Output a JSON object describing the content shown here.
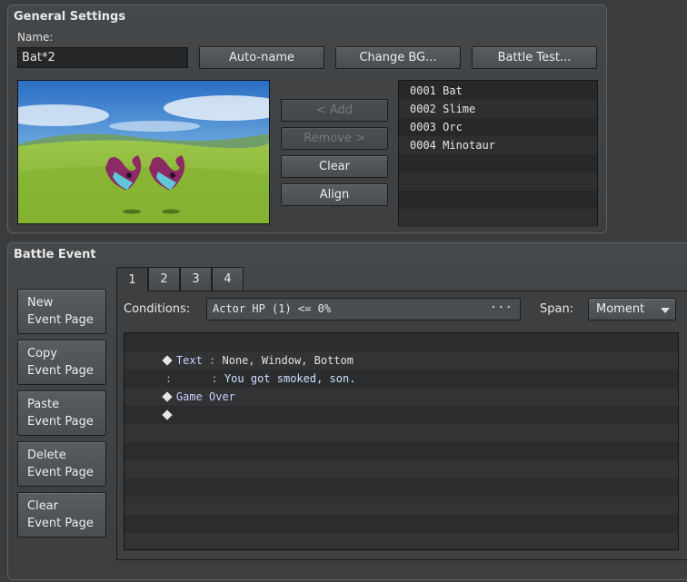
{
  "general": {
    "title": "General Settings",
    "name_label": "Name:",
    "name_value": "Bat*2",
    "autoname_label": "Auto-name",
    "changebg_label": "Change BG...",
    "battletest_label": "Battle Test...",
    "add_label": "< Add",
    "remove_label": "Remove >",
    "clear_label": "Clear",
    "align_label": "Align",
    "enemies": [
      "0001 Bat",
      "0002 Slime",
      "0003 Orc",
      "0004 Minotaur",
      "",
      "",
      "",
      ""
    ]
  },
  "battle_event": {
    "title": "Battle Event",
    "page_buttons": [
      "New\nEvent Page",
      "Copy\nEvent Page",
      "Paste\nEvent Page",
      "Delete\nEvent Page",
      "Clear\nEvent Page"
    ],
    "tabs": [
      "1",
      "2",
      "3",
      "4"
    ],
    "active_tab": "1",
    "conditions_label": "Conditions:",
    "conditions_value": "Actor HP (1) <= 0%",
    "conditions_more": "···",
    "span_label": "Span:",
    "span_value": "Moment",
    "commands": [
      {
        "marker": "diamond",
        "key": "Text",
        "sep": " : ",
        "args": "None, Window, Bottom"
      },
      {
        "marker": "",
        "key": ":     ",
        "sep": " : ",
        "args": "You got smoked, son."
      },
      {
        "marker": "diamond",
        "key": "Game Over",
        "sep": "",
        "args": ""
      },
      {
        "marker": "diamond",
        "key": "",
        "sep": "",
        "args": ""
      }
    ]
  },
  "colors": {
    "panel_bg": "#43464a",
    "list_bg": "#262829",
    "accent_text": "#c6d0ff"
  },
  "icons": {
    "dropdown": "triangle-down-icon",
    "command_marker": "diamond-icon"
  }
}
